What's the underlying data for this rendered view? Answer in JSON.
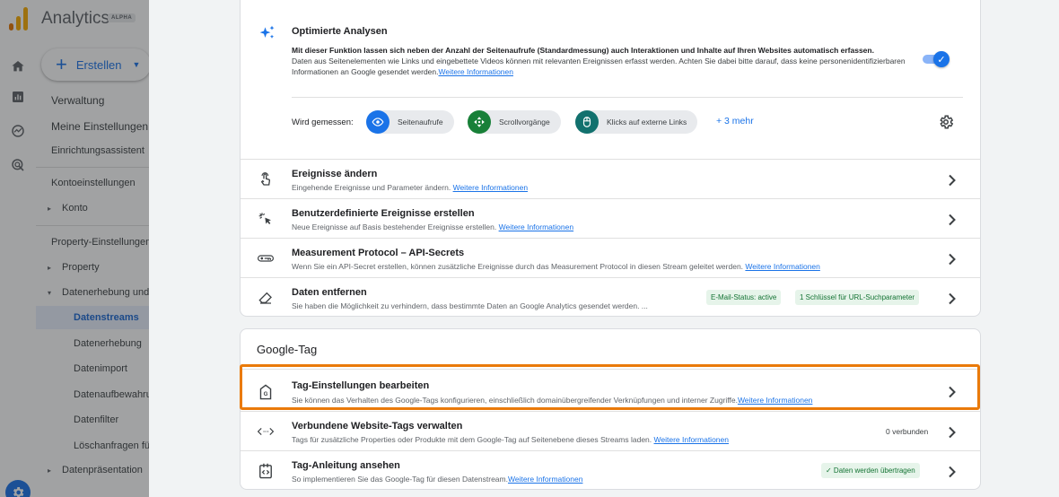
{
  "app": {
    "title": "Analytics",
    "badge": "ALPHA"
  },
  "create_button": {
    "label": "Erstellen"
  },
  "sidebar": {
    "items": [
      {
        "label": "Verwaltung"
      },
      {
        "label": "Meine Einstellungen"
      },
      {
        "label": "Einrichtungsassistent"
      },
      {
        "label": "Kontoeinstellungen"
      },
      {
        "label": "Konto"
      },
      {
        "label": "Property-Einstellungen"
      },
      {
        "label": "Property"
      },
      {
        "label": "Datenerhebung und -änderung"
      },
      {
        "label": "Datenstreams"
      },
      {
        "label": "Datenerhebung"
      },
      {
        "label": "Datenimport"
      },
      {
        "label": "Datenaufbewahrung"
      },
      {
        "label": "Datenfilter"
      },
      {
        "label": "Löschanfragen für Daten"
      },
      {
        "label": "Datenpräsentation"
      }
    ]
  },
  "enhanced": {
    "title": "Optimierte Analysen",
    "desc_bold": "Mit dieser Funktion lassen sich neben der Anzahl der Seitenaufrufe (Standardmessung) auch Interaktionen und Inhalte auf Ihren Websites automatisch erfassen.",
    "desc_text": "Daten aus Seitenelementen wie Links und eingebettete Videos können mit relevanten Ereignissen erfasst werden. Achten Sie dabei bitte darauf, dass keine personenidentifizierbaren Informationen an Google gesendet werden.",
    "link": "Weitere Informationen",
    "toggle_on": true,
    "measured_label": "Wird gemessen:",
    "chips": [
      "Seitenaufrufe",
      "Scrollvorgänge",
      "Klicks auf externe Links"
    ],
    "more": "+ 3 mehr"
  },
  "rows": [
    {
      "title": "Ereignisse ändern",
      "desc": "Eingehende Ereignisse und Parameter ändern.",
      "link": "Weitere Informationen"
    },
    {
      "title": "Benutzerdefinierte Ereignisse erstellen",
      "desc": "Neue Ereignisse auf Basis bestehender Ereignisse erstellen.",
      "link": "Weitere Informationen"
    },
    {
      "title": "Measurement Protocol – API-Secrets",
      "desc": "Wenn Sie ein API-Secret erstellen, können zusätzliche Ereignisse durch das Measurement Protocol in diesen Stream geleitet werden.",
      "link": "Weitere Informationen"
    },
    {
      "title": "Daten entfernen",
      "desc": "Sie haben die Möglichkeit zu verhindern, dass bestimmte Daten an Google Analytics gesendet werden. ...",
      "badge1": "E-Mail-Status: active",
      "badge2": "1 Schlüssel für URL-Suchparameter"
    }
  ],
  "google_tag": {
    "title": "Google-Tag",
    "rows": [
      {
        "title": "Tag-Einstellungen bearbeiten",
        "desc": "Sie können das Verhalten des Google-Tags konfigurieren, einschließlich domainübergreifender Verknüpfungen und interner Zugriffe.",
        "link": "Weitere Informationen"
      },
      {
        "title": "Verbundene Website-Tags verwalten",
        "desc": "Tags für zusätzliche Properties oder Produkte mit dem Google-Tag auf Seitenebene dieses Streams laden.",
        "link": "Weitere Informationen",
        "status": "0 verbunden"
      },
      {
        "title": "Tag-Anleitung ansehen",
        "desc": "So implementieren Sie das Google-Tag für diesen Datenstream.",
        "link": "Weitere Informationen",
        "status": "✓ Daten werden übertragen"
      }
    ]
  },
  "colors": {
    "accent": "#1a73e8",
    "highlight": "#ea7a0a",
    "success_bg": "#e6f4ea",
    "success_text": "#137333",
    "logo_orange": "#f9ab00",
    "logo_dark": "#e37400"
  },
  "icons": [
    "analytics-logo-icon",
    "home-icon",
    "reports-icon",
    "explore-icon",
    "advertising-icon",
    "sparkle-icon",
    "eye-icon",
    "scroll-icon",
    "mouse-icon",
    "settings-gear-icon",
    "touch-icon",
    "click-icon",
    "key-icon",
    "eraser-icon",
    "tag-icon",
    "code-icon",
    "guide-icon",
    "chevron-right-icon"
  ]
}
